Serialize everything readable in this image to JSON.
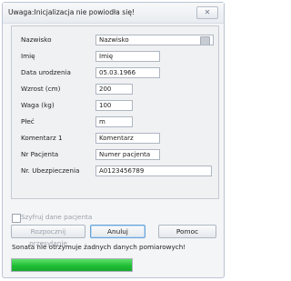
{
  "window": {
    "title": "Uwaga:Inicjalizacja nie powiodła się!",
    "close_label": "✕"
  },
  "form": {
    "fields": [
      {
        "label": "Nazwisko",
        "value": "Nazwisko"
      },
      {
        "label": "Imię",
        "value": "Imię"
      },
      {
        "label": "Data urodzenia",
        "value": "05.03.1966"
      },
      {
        "label": "Wzrost (cm)",
        "value": "200"
      },
      {
        "label": "Waga (kg)",
        "value": "100"
      },
      {
        "label": "Płeć",
        "value": "m"
      },
      {
        "label": "Komentarz 1",
        "value": "Komentarz"
      },
      {
        "label": "Nr Pacjenta",
        "value": "Numer pacjenta"
      },
      {
        "label": "Nr. Ubezpieczenia",
        "value": "A0123456789"
      }
    ]
  },
  "encrypt": {
    "label": "Szyfruj dane pacjenta",
    "checked": false
  },
  "buttons": {
    "start": "Rozpocznij przesyłanie",
    "cancel": "Anuluj",
    "help": "Pomoc"
  },
  "status": {
    "message": "Sonata nie otrzymuje żadnych danych pomiarowych!",
    "progress_percent": 100,
    "progress_color": "#1fbf35"
  }
}
